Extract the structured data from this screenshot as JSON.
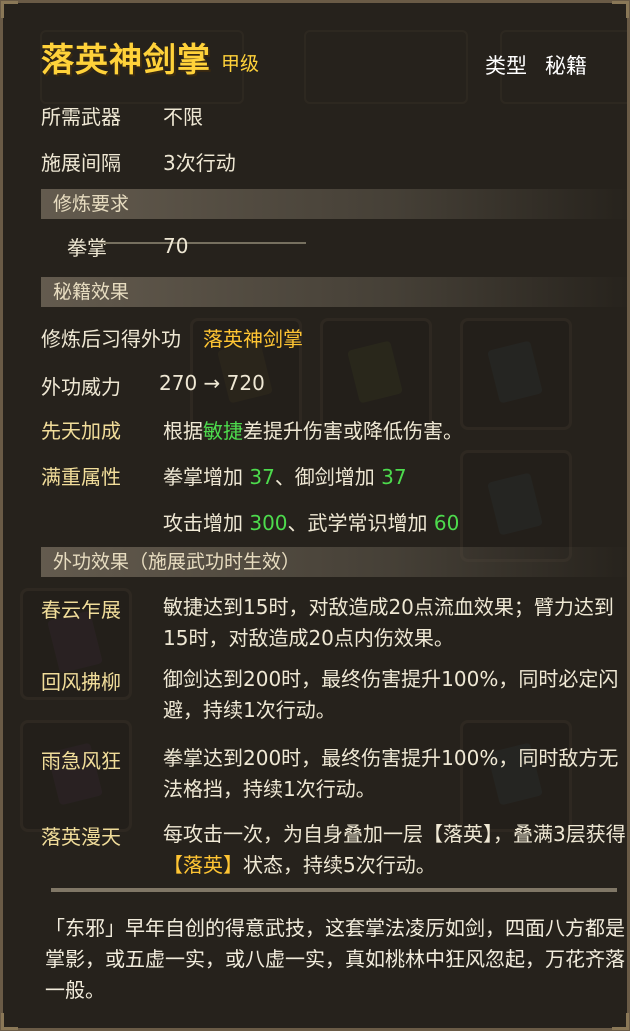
{
  "header": {
    "title": "落英神剑掌",
    "grade": "甲级",
    "type_label": "类型",
    "type_value": "秘籍"
  },
  "info": [
    {
      "label": "所需武器",
      "value": "不限"
    },
    {
      "label": "施展间隔",
      "value": "3次行动"
    }
  ],
  "sections": {
    "requirement": "修炼要求",
    "effects": "秘籍效果",
    "external_effects": "外功效果（施展武功时生效）"
  },
  "requirement": {
    "label": "拳掌",
    "value": "70"
  },
  "learn": {
    "label": "修炼后习得外功",
    "value": "落英神剑掌"
  },
  "power": {
    "label": "外功威力",
    "value": "270 → 720"
  },
  "innate": {
    "label": "先天加成",
    "pre": "根据",
    "attr": "敏捷",
    "post": "差提升伤害或降低伤害。"
  },
  "full_attr": {
    "label": "满重属性",
    "line1": {
      "a": "拳掌增加 ",
      "av": "37",
      "sep": "、御剑增加 ",
      "bv": "37"
    },
    "line2": {
      "a": "攻击增加 ",
      "av": "300",
      "sep": "、武学常识增加 ",
      "bv": "60"
    }
  },
  "skills": [
    {
      "name": "春云乍展",
      "text": "敏捷达到15时，对敌造成20点流血效果；臂力达到15时，对敌造成20点内伤效果。"
    },
    {
      "name": "回风拂柳",
      "text": "御剑达到200时，最终伤害提升100%，同时必定闪避，持续1次行动。"
    },
    {
      "name": "雨急风狂",
      "text": "拳掌达到200时，最终伤害提升100%，同时敌方无法格挡，持续1次行动。"
    },
    {
      "name": "落英漫天",
      "text_a": "每攻击一次，为自身叠加一层【落英】，叠满3层获得",
      "text_hl": "【落英】",
      "text_b": "状态，持续5次行动。"
    }
  ],
  "description": "「东邪」早年自创的得意武技，这套掌法凌厉如剑，四面八方都是掌影，或五虚一实，或八虚一实，真如桃林中狂风忽起，万花齐落一般。",
  "colors": {
    "title": "#ffd23a",
    "highlight": "#ffc533",
    "green": "#4ddb4d"
  }
}
